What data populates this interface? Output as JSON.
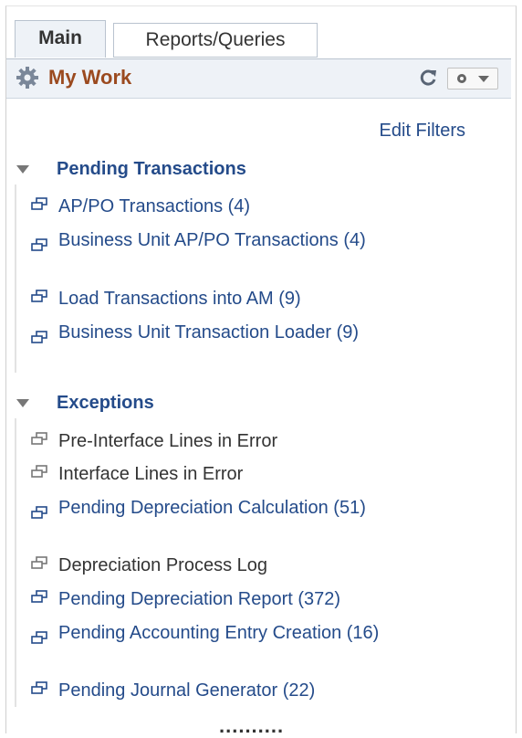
{
  "tabs": [
    {
      "label": "Main",
      "active": true
    },
    {
      "label": "Reports/Queries",
      "active": false
    }
  ],
  "header": {
    "title": "My Work",
    "title_color": "#9b4a1f",
    "icons": [
      "gears-icon",
      "refresh-icon",
      "settings-dropdown-icon"
    ]
  },
  "edit_filters": "Edit Filters",
  "sections": [
    {
      "title": "Pending Transactions",
      "items": [
        {
          "label": "AP/PO Transactions (4)",
          "link": true
        },
        {
          "label": "Business Unit AP/PO Transactions (4)",
          "link": true
        },
        {
          "label": "Load Transactions into AM (9)",
          "link": true
        },
        {
          "label": "Business Unit Transaction Loader (9)",
          "link": true
        }
      ]
    },
    {
      "title": "Exceptions",
      "items": [
        {
          "label": "Pre-Interface Lines in Error",
          "link": false
        },
        {
          "label": "Interface Lines in Error",
          "link": false
        },
        {
          "label": "Pending Depreciation Calculation (51)",
          "link": true
        },
        {
          "label": "Depreciation Process Log",
          "link": false
        },
        {
          "label": "Pending Depreciation Report (372)",
          "link": true
        },
        {
          "label": "Pending Accounting Entry Creation (16)",
          "link": true
        },
        {
          "label": "Pending Journal Generator (22)",
          "link": true
        }
      ]
    }
  ],
  "more_indicator": ".........."
}
